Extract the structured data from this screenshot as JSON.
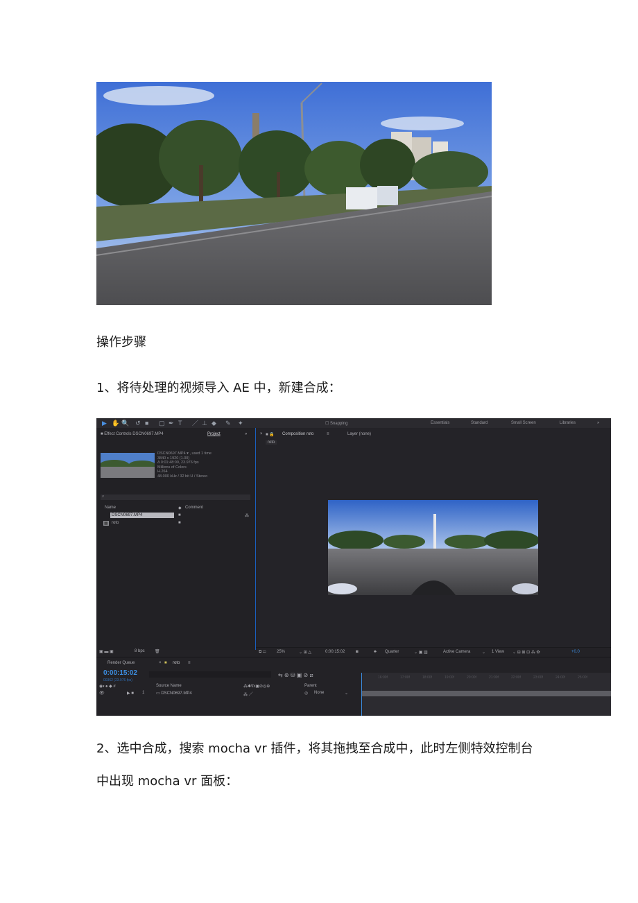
{
  "doc": {
    "heading": "操作步骤",
    "step1": "1、将待处理的视频导入 AE 中，新建合成：",
    "step2_line1": "2、选中合成，搜索 mocha vr 插件，将其拖拽至合成中，此时左侧特效控制台",
    "step2_line2": "中出现 mocha vr 面板："
  },
  "ae": {
    "toolbar": {
      "snapping": "Snapping",
      "workspaces": [
        "Essentials",
        "Standard",
        "Small Screen",
        "Libraries"
      ]
    },
    "left_panel": {
      "tab_effect_controls": "Effect Controls DSCN0697.MP4",
      "tab_project": "Project",
      "footage_info": [
        "DSCN0697.MP4 ▾ , used 1 time",
        "3840 x 1920 (1.00)",
        "Δ 0:01:48:00, 23.976 fps",
        "Millions of Colors",
        "H.264",
        "48.000 kHz / 32 bit U / Stereo"
      ],
      "col_name": "Name",
      "col_comment": "Comment",
      "items": [
        "DSCN0697.MP4",
        "roto"
      ],
      "bpc": "8 bpc"
    },
    "viewer": {
      "tab_composition": "Composition roto",
      "tab_layer": "Layer (none)",
      "subtab": "roto",
      "zoom": "25%",
      "time": "0:00:15:02",
      "resolution": "Quarter",
      "camera": "Active Camera",
      "view": "1 View",
      "exposure": "+0.0"
    },
    "timeline": {
      "tab_render_queue": "Render Queue",
      "tab_roto": "roto",
      "timecode": "0:00:15:02",
      "fps_line": "00362 (23.976 fps)",
      "col_source": "Source Name",
      "col_parent": "Parent",
      "layer_num": "1",
      "layer_name": "DSCN0697.MP4",
      "parent_value": "None",
      "ticks": [
        "16:00f",
        "17:00f",
        "18:00f",
        "19:00f",
        "20:00f",
        "21:00f",
        "22:00f",
        "23:00f",
        "24:00f",
        "25:00f"
      ]
    }
  }
}
